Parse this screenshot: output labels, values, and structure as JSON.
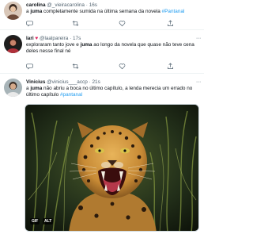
{
  "tweets": [
    {
      "name": "carolina",
      "handle": "@_vieiracarolina",
      "dot": "·",
      "time": "16s",
      "text_pre": "a ",
      "text_bold": "juma",
      "text_post": " completamente sumida na última semana da novela ",
      "hashtag": "#Pantanal"
    },
    {
      "name": "lari",
      "handle": "@laalpareira",
      "dot": "·",
      "time": "17s",
      "text_pre": "exploraram tanto jove e ",
      "text_bold": "juma",
      "text_post": " ao longo da novela que quase não teve cena deles nesse final né",
      "hashtag": ""
    },
    {
      "name": "Vinicius",
      "handle": "@vinicius___accp",
      "dot": "·",
      "time": "21s",
      "text_pre": "a ",
      "text_bold": "juma",
      "text_post": " não abriu a boca no último capítulo, a lenda merecia um errado no último capítulo ",
      "hashtag": "#pantanal"
    }
  ],
  "media": {
    "gif_label": "GIF",
    "alt_label": "ALT"
  },
  "icons": {
    "reply": "reply-icon",
    "retweet": "retweet-icon",
    "like": "like-icon",
    "share": "share-icon",
    "more": "more-icon"
  },
  "colors": {
    "link": "#1d9bf0",
    "muted": "#536471"
  }
}
